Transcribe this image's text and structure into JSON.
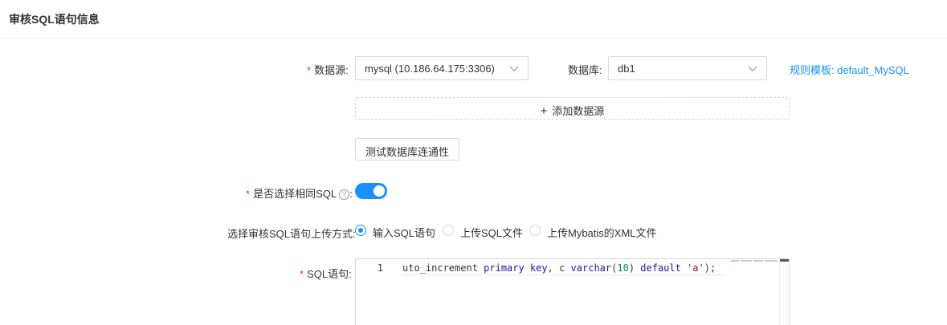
{
  "header": {
    "title": "审核SQL语句信息"
  },
  "datasource": {
    "label": "数据源:",
    "value": "mysql (10.186.64.175:3306)",
    "db_label": "数据库:",
    "db_value": "db1",
    "rule_link": "规则模板: default_MySQL",
    "add_button": "添加数据源",
    "test_button": "测试数据库连通性"
  },
  "same_sql": {
    "label": "是否选择相同SQL",
    "help_icon": "question-circle-icon",
    "enabled": true
  },
  "upload_mode": {
    "label": "选择审核SQL语句上传方式:",
    "options": [
      {
        "label": "输入SQL语句",
        "checked": true
      },
      {
        "label": "上传SQL文件",
        "checked": false
      },
      {
        "label": "上传Mybatis的XML文件",
        "checked": false
      }
    ]
  },
  "sql": {
    "label": "SQL语句:",
    "line_number": "1",
    "code_plain1": "uto_increment ",
    "code_kw1": "primary key",
    "code_plain2": ", c ",
    "code_kw2": "varchar",
    "code_plain3": "(",
    "code_num": "10",
    "code_plain4": ") ",
    "code_kw3": "default",
    "code_plain5": " ",
    "code_str": "'a'",
    "code_plain6": ");"
  },
  "colors": {
    "accent": "#1890ff",
    "required": "#e33333"
  }
}
